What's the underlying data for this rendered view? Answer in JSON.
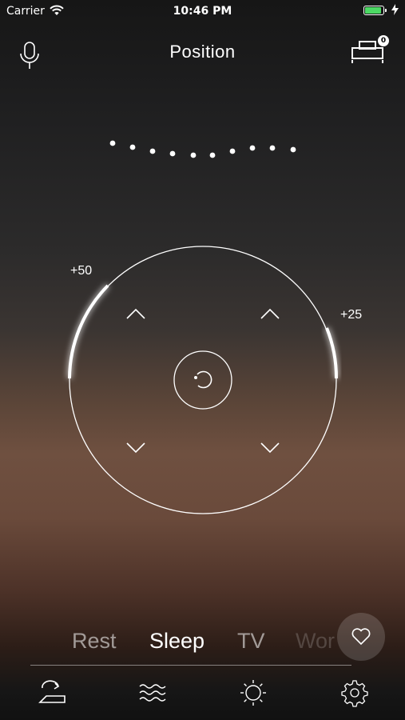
{
  "status_bar": {
    "carrier": "Carrier",
    "time": "10:46 PM",
    "battery_color": "#4cd964"
  },
  "header": {
    "title": "Position",
    "mic_icon": "microphone-icon",
    "bed_icon": "bed-icon",
    "bed_badge": "0"
  },
  "position_indicator": {
    "dot_count": 10
  },
  "dial": {
    "left_label": "+50",
    "right_label": "+25",
    "left_level": 0.5,
    "right_level": 0.25,
    "controls": [
      "head-up",
      "foot-up",
      "head-down",
      "foot-down",
      "reset"
    ]
  },
  "modes": {
    "items": [
      "Rest",
      "Sleep",
      "TV",
      "Wor"
    ],
    "selected": "Sleep"
  },
  "favorite_icon": "heart-icon",
  "tabs": [
    {
      "name": "position",
      "icon": "position-icon",
      "active": true
    },
    {
      "name": "massage",
      "icon": "waves-icon",
      "active": false
    },
    {
      "name": "light",
      "icon": "sun-icon",
      "active": false
    },
    {
      "name": "settings",
      "icon": "gear-icon",
      "active": false
    }
  ]
}
